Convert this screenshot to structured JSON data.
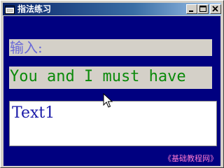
{
  "window": {
    "title": "指法练习",
    "icons": {
      "app": "app-form-icon",
      "minimize": "minimize-icon",
      "maximize": "maximize-icon",
      "close": "close-icon"
    }
  },
  "form": {
    "prompt_label": "输入:",
    "sentence_label": "You and I must have",
    "text_input_value": "Text1",
    "watermark": "《基础教程网》"
  },
  "colors": {
    "client_background": "#000080",
    "label_background": "#d4d0c8",
    "prompt_text": "#6a6ad8",
    "sentence_text": "#0a8a0a",
    "input_text": "#1a1aa8",
    "watermark_text": "#ff7ad0"
  },
  "pointer": {
    "icon": "mouse-pointer-icon"
  }
}
